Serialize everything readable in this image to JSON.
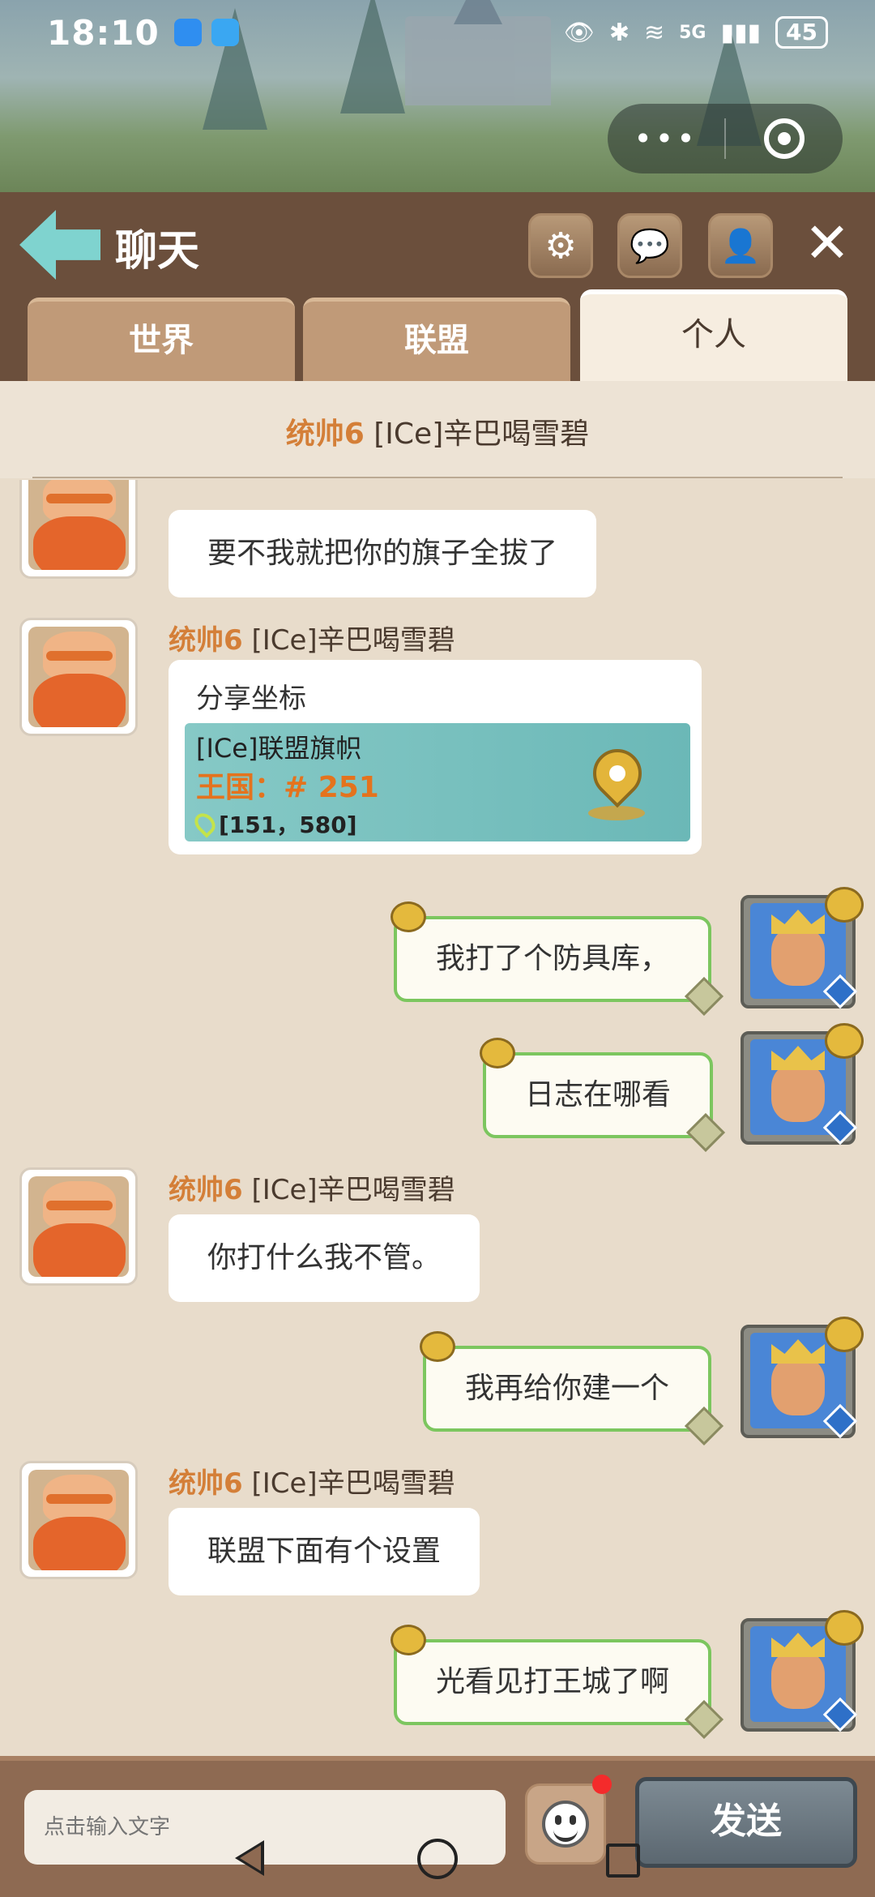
{
  "status_bar": {
    "time": "18:10",
    "network": "5G",
    "battery": "45"
  },
  "header": {
    "title": "聊天",
    "tabs": [
      {
        "label": "世界",
        "active": false
      },
      {
        "label": "联盟",
        "active": false
      },
      {
        "label": "个人",
        "active": true
      }
    ]
  },
  "conversation": {
    "rank": "统帅6",
    "name": "[ICe]辛巴喝雪碧"
  },
  "messages": [
    {
      "side": "left",
      "text": "要不我就把你的旗子全拔了"
    },
    {
      "side": "left",
      "rank": "统帅6",
      "name": "[ICe]辛巴喝雪碧",
      "share": {
        "title": "分享坐标",
        "location_name": "[ICe]联盟旗帜",
        "kingdom": "王国：# 251",
        "coords": "[151，580]"
      }
    },
    {
      "side": "right",
      "text": "我打了个防具库，"
    },
    {
      "side": "right",
      "text": "日志在哪看"
    },
    {
      "side": "left",
      "rank": "统帅6",
      "name": "[ICe]辛巴喝雪碧",
      "text": "你打什么我不管。"
    },
    {
      "side": "right",
      "text": "我再给你建一个"
    },
    {
      "side": "left",
      "rank": "统帅6",
      "name": "[ICe]辛巴喝雪碧",
      "text": "联盟下面有个设置"
    },
    {
      "side": "right",
      "text": "光看见打王城了啊"
    }
  ],
  "input": {
    "placeholder": "点击输入文字",
    "send_label": "发送"
  },
  "icons": {
    "back": "back-arrow-icon",
    "settings": "gear-icon",
    "chat_rooms": "chat-bubbles-icon",
    "contacts": "person-icon",
    "close": "close-icon",
    "emoji": "smiley-icon"
  },
  "colors": {
    "rank": "#d47f38",
    "bubble_border_self": "#7cc65f",
    "header_bg": "#6b4f3c"
  }
}
